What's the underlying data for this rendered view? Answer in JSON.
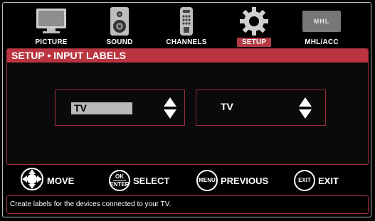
{
  "menu": {
    "items": [
      {
        "label": "PICTURE",
        "icon": "picture-icon"
      },
      {
        "label": "SOUND",
        "icon": "speaker-icon"
      },
      {
        "label": "CHANNELS",
        "icon": "remote-icon"
      },
      {
        "label": "SETUP",
        "icon": "gear-icon",
        "active": true
      },
      {
        "label": "MHL/ACC",
        "icon": "mhl-logo-icon",
        "logo_text": "MHL"
      }
    ]
  },
  "panel": {
    "title": "SETUP • INPUT LABELS",
    "left_field_value": "TV",
    "right_field_value": "TV"
  },
  "help": {
    "move": "MOVE",
    "ok_top": "OK",
    "ok_bottom": "ENTER",
    "select": "SELECT",
    "menu_btn": "MENU",
    "previous": "PREVIOUS",
    "exit_btn": "EXIT",
    "exit": "EXIT"
  },
  "status_text": "Create labels for the devices connected to your TV.",
  "colors": {
    "accent": "#bb3540",
    "background": "#000000"
  }
}
